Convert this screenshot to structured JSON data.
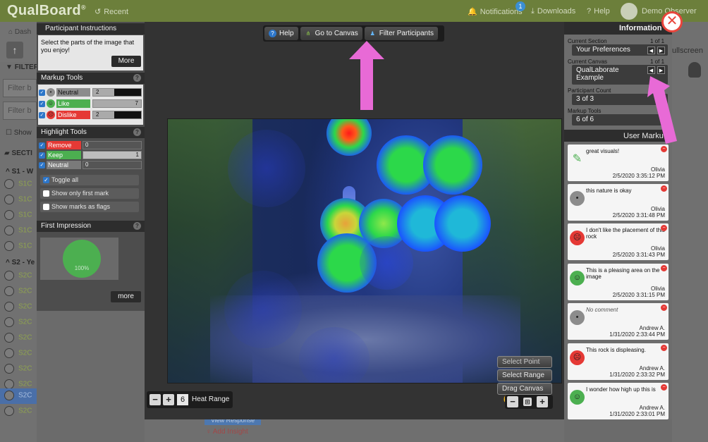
{
  "app": {
    "brand": "QualBoard",
    "brand_mark": "®",
    "nav": {
      "recent": "Recent",
      "notifications": "Notifications",
      "notifications_badge": "1",
      "downloads": "Downloads",
      "help": "Help",
      "user": "Demo Observer"
    }
  },
  "background": {
    "dashboard_crumb": "Dash",
    "filter_label": "FILTER",
    "filter_input_1": "Filter b",
    "filter_input_2": "Filter b",
    "show_label": "Show",
    "sections_label": "SECTI",
    "section_1": "S1 - W",
    "section_2": "S2 - Ye",
    "rows_s1": [
      "S1C",
      "S1C",
      "S1C",
      "S1C",
      "S1C"
    ],
    "rows_s2": [
      "S2C",
      "S2C",
      "S2C",
      "S2C",
      "S2C",
      "S2C",
      "S2C",
      "S2C",
      "S2C",
      "S2C"
    ],
    "fullscreen": "ullscreen",
    "view_response": "View Response",
    "add_insight": "Add Insight"
  },
  "toolbar": {
    "help": "Help",
    "go_to_canvas": "Go to Canvas",
    "filter_participants": "Filter Participants"
  },
  "instructions": {
    "header": "Participant Instructions",
    "text": "Select the parts of the image that you enjoy!",
    "more": "More"
  },
  "markup_tools": {
    "header": "Markup Tools",
    "items": [
      {
        "label": "Neutral",
        "count": "2",
        "color": "#8c8c8c"
      },
      {
        "label": "Like",
        "count": "7",
        "color": "#4caf50"
      },
      {
        "label": "Dislike",
        "count": "2",
        "color": "#e53935"
      }
    ]
  },
  "highlight_tools": {
    "header": "Highlight Tools",
    "items": [
      {
        "label": "Remove",
        "value": "0",
        "color": "#e53935"
      },
      {
        "label": "Keep",
        "value": "1",
        "color": "#4caf50"
      },
      {
        "label": "Neutral",
        "value": "0",
        "color": "#7a7a7a"
      }
    ],
    "toggle_all": "Toggle all",
    "only_first_mark": "Show only first mark",
    "marks_as_flags": "Show marks as flags"
  },
  "first_impression": {
    "header": "First Impression",
    "percent": "100%",
    "more": "more"
  },
  "canvas_controls": {
    "select_point": "Select Point",
    "select_range": "Select Range",
    "drag_canvas": "Drag Canvas",
    "heat_range_value": "6",
    "heat_range_label": "Heat Range"
  },
  "information": {
    "title": "Information",
    "current_section_label": "Current Section",
    "current_section_count": "1 of 1",
    "current_section": "Your Preferences",
    "current_canvas_label": "Current Canvas",
    "current_canvas_count": "1 of 1",
    "current_canvas": "QualLaborate Example",
    "participant_count_label": "Participant Count",
    "participant_count": "3 of 3",
    "markup_tools_label": "Markup Tools",
    "markup_tools": "6 of 6",
    "user_markup_header": "User Marku"
  },
  "user_markups": [
    {
      "type": "highlight",
      "text": "great visuals!",
      "user": "Olivia",
      "time": "2/5/2020 3:35:12 PM"
    },
    {
      "type": "neutral",
      "text": "this nature is okay",
      "user": "Olivia",
      "time": "2/5/2020 3:31:48 PM"
    },
    {
      "type": "dislike",
      "text": "I don't like the placement of this rock",
      "user": "Olivia",
      "time": "2/5/2020 3:31:43 PM"
    },
    {
      "type": "like",
      "text": "This is a pleasing area on the image",
      "user": "Olivia",
      "time": "2/5/2020 3:31:15 PM"
    },
    {
      "type": "neutral",
      "text": "No comment",
      "user": "Andrew A.",
      "time": "1/31/2020 2:33:44 PM"
    },
    {
      "type": "dislike",
      "text": "This rock is displeasing.",
      "user": "Andrew A.",
      "time": "1/31/2020 2:33:32 PM"
    },
    {
      "type": "like",
      "text": "I wonder how high up this is",
      "user": "Andrew A.",
      "time": "1/31/2020 2:33:01 PM"
    }
  ],
  "colors": {
    "appbar": "#6c7f3b",
    "like": "#4caf50",
    "dislike": "#e53935",
    "neutral": "#8c8c8c",
    "annotation_arrow": "#e86ad6",
    "close": "#e8453c"
  }
}
